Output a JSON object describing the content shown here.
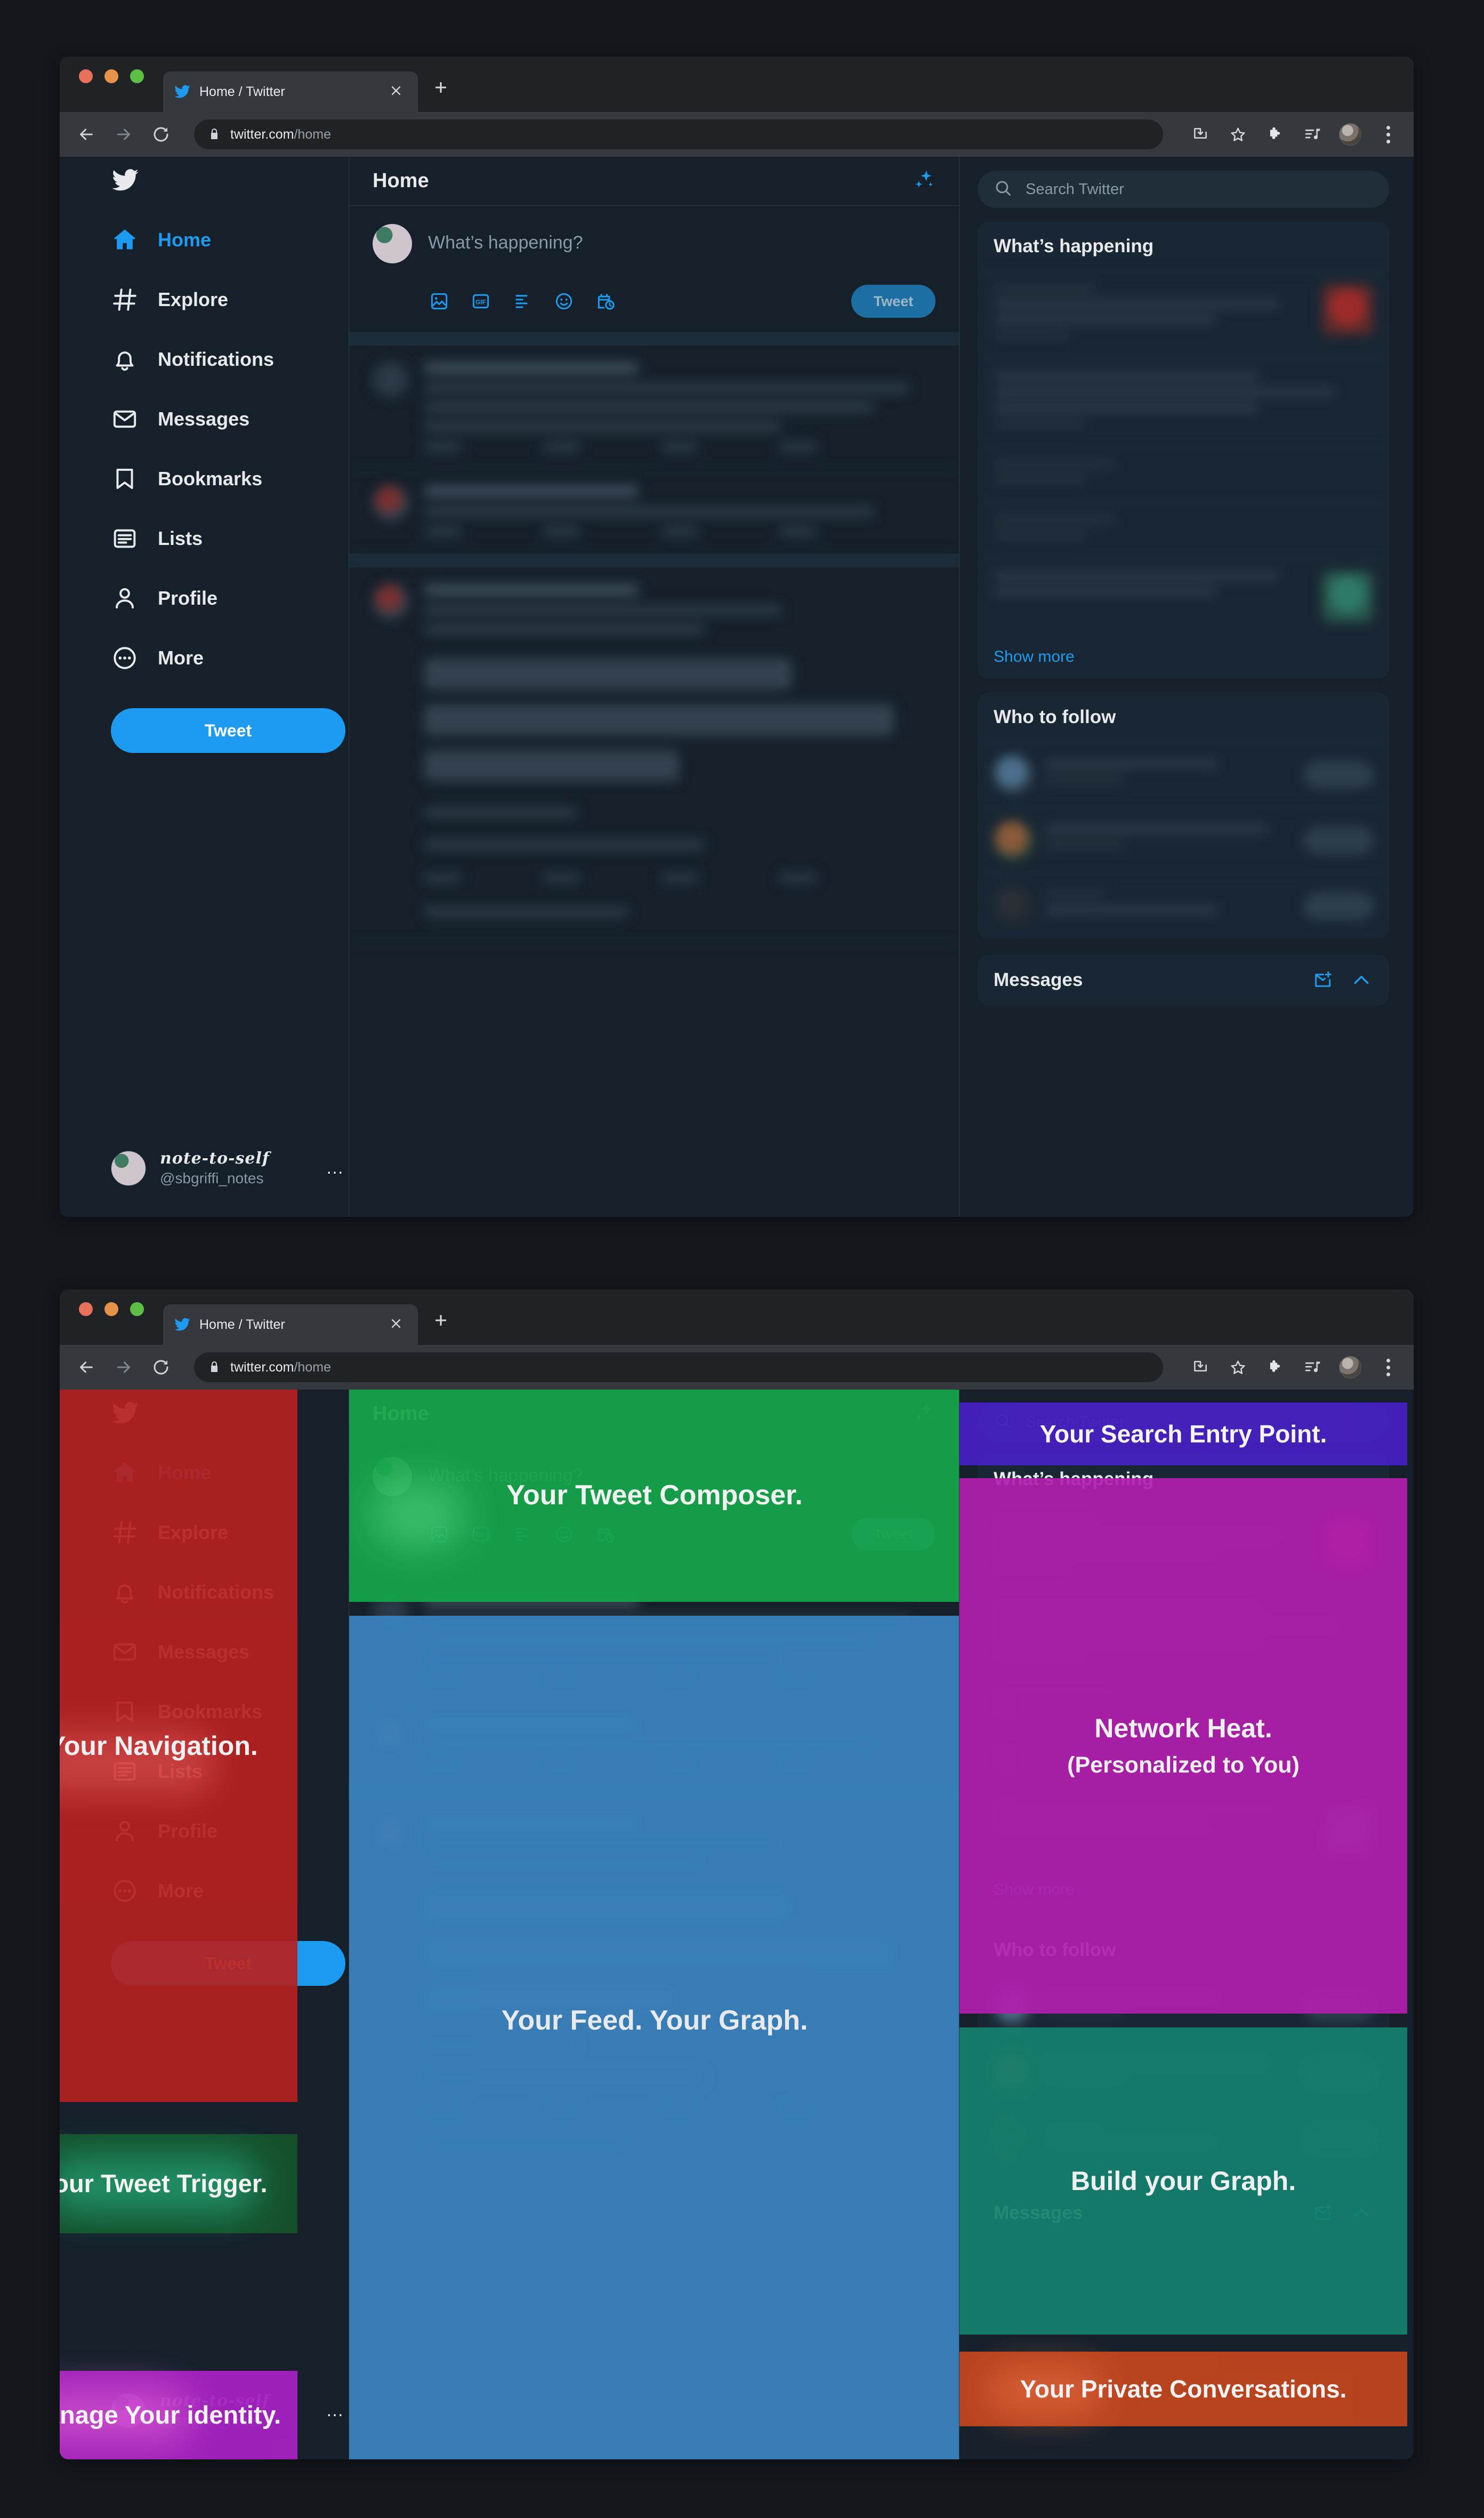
{
  "browser": {
    "tab_title": "Home / Twitter",
    "tab_close": "×",
    "new_tab": "+",
    "url_domain": "twitter.com",
    "url_path": "/home",
    "back_icon": "back-arrow-icon",
    "forward_icon": "forward-arrow-icon",
    "reload_icon": "reload-icon",
    "lock_icon": "lock-icon",
    "toolbar_icons": [
      "download-icon",
      "bookmark-star-icon",
      "extensions-puzzle-icon",
      "media-control-icon",
      "profile-avatar-icon",
      "kebab-menu-icon"
    ]
  },
  "sidebar": {
    "logo": "twitter-bird-logo",
    "items": [
      {
        "label": "Home",
        "icon": "home-icon",
        "active": true
      },
      {
        "label": "Explore",
        "icon": "hashtag-icon",
        "active": false
      },
      {
        "label": "Notifications",
        "icon": "bell-icon",
        "active": false
      },
      {
        "label": "Messages",
        "icon": "envelope-icon",
        "active": false
      },
      {
        "label": "Bookmarks",
        "icon": "bookmark-icon",
        "active": false
      },
      {
        "label": "Lists",
        "icon": "list-icon",
        "active": false
      },
      {
        "label": "Profile",
        "icon": "person-icon",
        "active": false
      },
      {
        "label": "More",
        "icon": "more-circle-icon",
        "active": false
      }
    ],
    "tweet_button": "Tweet",
    "profile": {
      "display_name": "note-to-self",
      "handle": "@sbgriffi_notes",
      "overflow": "…"
    }
  },
  "center": {
    "title": "Home",
    "sparkle_icon": "sparkle-icon",
    "composer": {
      "placeholder": "What’s happening?",
      "icons": [
        "image-icon",
        "gif-icon",
        "poll-icon",
        "emoji-icon",
        "schedule-icon"
      ],
      "tweet_button": "Tweet"
    }
  },
  "right": {
    "search": {
      "placeholder": "Search Twitter",
      "icon": "search-icon"
    },
    "whats_happening": {
      "title": "What’s happening",
      "show_more": "Show more"
    },
    "who_to_follow": {
      "title": "Who to follow"
    },
    "messages": {
      "title": "Messages",
      "new_message_icon": "new-message-icon",
      "expand_icon": "chevron-up-icon"
    }
  },
  "annotations": {
    "navigation": {
      "text": "Your Navigation.",
      "color": "#b5201f"
    },
    "tweet_trigger": {
      "text": "Your Tweet Trigger.",
      "color": "#15532c"
    },
    "identity": {
      "text": "Manage Your identity.",
      "color": "#a522c0"
    },
    "composer": {
      "text": "Your Tweet Composer.",
      "color": "#16a44a"
    },
    "feed": {
      "text": "Your Feed. Your Graph.",
      "color": "#3b86c4"
    },
    "search_entry": {
      "text": "Your Search Entry Point.",
      "color": "#4521c0"
    },
    "network_heat": {
      "text": "Network Heat.",
      "subtext": "(Personalized to You)",
      "color": "#b01ead"
    },
    "build_graph": {
      "text": "Build your Graph.",
      "color": "#15806e"
    },
    "private_conversations": {
      "text": "Your Private Conversations.",
      "color": "#c0451f"
    }
  },
  "colors": {
    "twitter_blue": "#1d9bf0",
    "app_bg": "#15202b",
    "card_bg": "#192734",
    "border": "#2f3b45",
    "muted_text": "#8899a6"
  }
}
